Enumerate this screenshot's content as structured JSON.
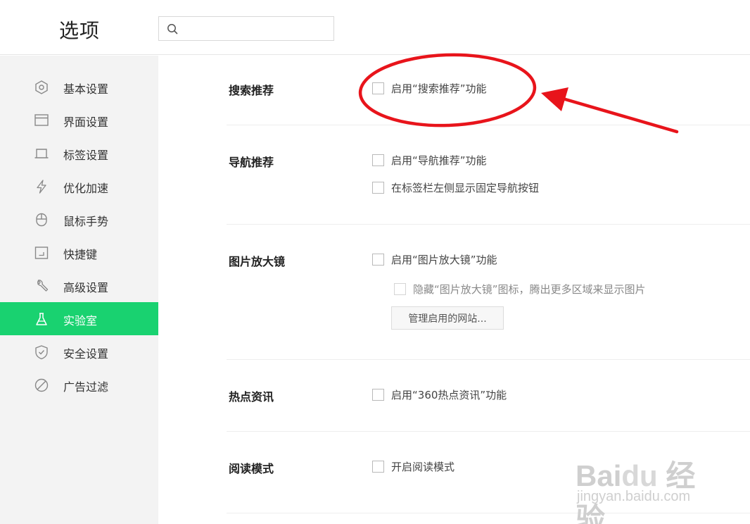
{
  "header": {
    "title": "选项",
    "search": {
      "value": "",
      "placeholder": ""
    }
  },
  "sidebar": {
    "items": [
      {
        "label": "基本设置",
        "icon": "hexagon-icon",
        "active": false
      },
      {
        "label": "界面设置",
        "icon": "window-icon",
        "active": false
      },
      {
        "label": "标签设置",
        "icon": "tab-icon",
        "active": false
      },
      {
        "label": "优化加速",
        "icon": "lightning-icon",
        "active": false
      },
      {
        "label": "鼠标手势",
        "icon": "mouse-icon",
        "active": false
      },
      {
        "label": "快捷键",
        "icon": "keyboard-icon",
        "active": false
      },
      {
        "label": "高级设置",
        "icon": "wrench-icon",
        "active": false
      },
      {
        "label": "实验室",
        "icon": "flask-icon",
        "active": true
      },
      {
        "label": "安全设置",
        "icon": "shield-icon",
        "active": false
      },
      {
        "label": "广告过滤",
        "icon": "block-icon",
        "active": false
      }
    ],
    "active_color": "#19d270"
  },
  "sections": {
    "search_recommend": {
      "title": "搜索推荐",
      "options": [
        {
          "label": "启用“搜索推荐”功能",
          "checked": false
        }
      ]
    },
    "nav_recommend": {
      "title": "导航推荐",
      "options": [
        {
          "label": "启用“导航推荐”功能",
          "checked": false
        },
        {
          "label": "在标签栏左侧显示固定导航按钮",
          "checked": false
        }
      ]
    },
    "image_magnifier": {
      "title": "图片放大镜",
      "options": [
        {
          "label": "启用“图片放大镜”功能",
          "checked": false
        },
        {
          "label": "隐藏“图片放大镜”图标，腾出更多区域来显示图片",
          "checked": false,
          "disabled": true
        }
      ],
      "button_label": "管理启用的网站..."
    },
    "hot_news": {
      "title": "热点资讯",
      "options": [
        {
          "label": "启用“360热点资讯”功能",
          "checked": false
        }
      ]
    },
    "reading_mode": {
      "title": "阅读模式",
      "options": [
        {
          "label": "开启阅读模式",
          "checked": false
        }
      ]
    }
  },
  "annotation": {
    "color": "#e8141b",
    "shape": "ellipse-and-arrow"
  },
  "watermark": {
    "logo": "Bai du 经验",
    "url": "jingyan.baidu.com"
  }
}
